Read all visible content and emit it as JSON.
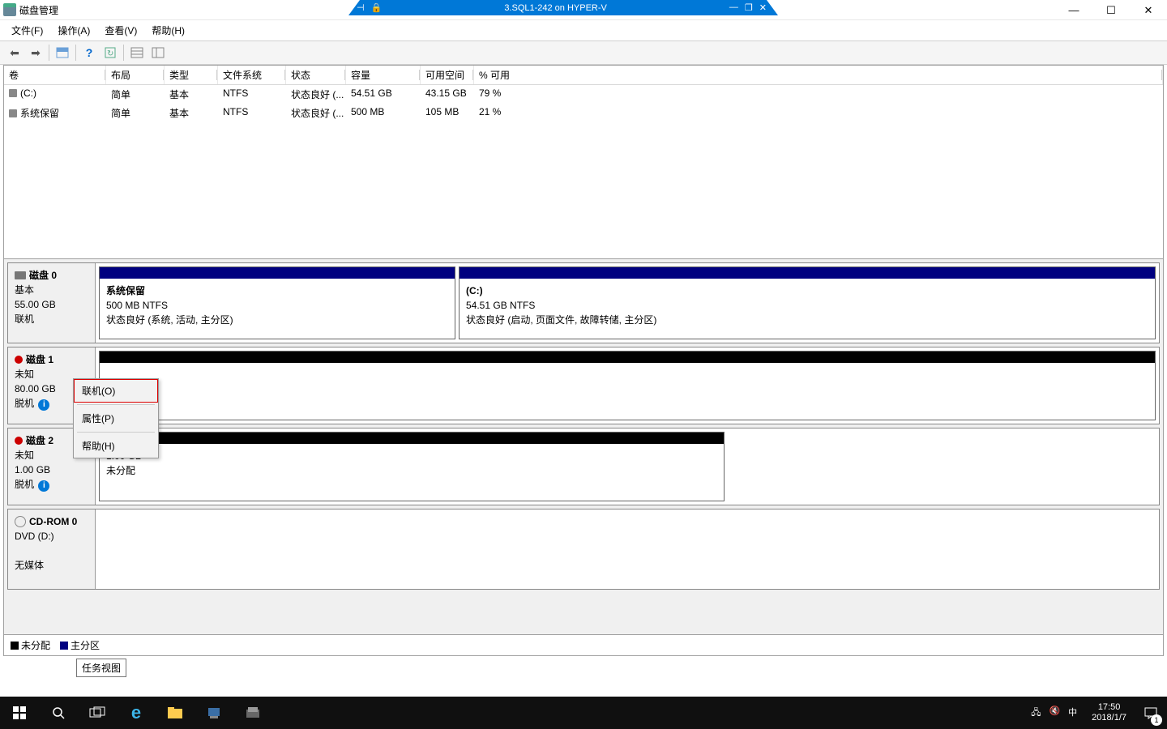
{
  "window": {
    "title": "磁盘管理",
    "vm_title": "3.SQL1-242 on HYPER-V"
  },
  "menu": {
    "file": "文件(F)",
    "action": "操作(A)",
    "view": "查看(V)",
    "help": "帮助(H)"
  },
  "columns": {
    "name": "卷",
    "layout": "布局",
    "type": "类型",
    "fs": "文件系统",
    "status": "状态",
    "cap": "容量",
    "free": "可用空间",
    "pct": "% 可用"
  },
  "volumes": [
    {
      "name": "(C:)",
      "layout": "简单",
      "type": "基本",
      "fs": "NTFS",
      "status": "状态良好 (...",
      "cap": "54.51 GB",
      "free": "43.15 GB",
      "pct": "79 %"
    },
    {
      "name": "系统保留",
      "layout": "简单",
      "type": "基本",
      "fs": "NTFS",
      "status": "状态良好 (...",
      "cap": "500 MB",
      "free": "105 MB",
      "pct": "21 %"
    }
  ],
  "disks": {
    "d0": {
      "name": "磁盘 0",
      "type": "基本",
      "size": "55.00 GB",
      "state": "联机",
      "p1": {
        "name": "系统保留",
        "line2": "500 MB NTFS",
        "line3": "状态良好 (系统, 活动, 主分区)"
      },
      "p2": {
        "name": "(C:)",
        "line2": "54.51 GB NTFS",
        "line3": "状态良好 (启动, 页面文件, 故障转储, 主分区)"
      }
    },
    "d1": {
      "name": "磁盘 1",
      "type": "未知",
      "size": "80.00 GB",
      "state": "脱机"
    },
    "d2": {
      "name": "磁盘 2",
      "type": "未知",
      "size": "1.00 GB",
      "state": "脱机",
      "p1": {
        "line2": "1.00 GB",
        "line3": "未分配"
      }
    },
    "cd": {
      "name": "CD-ROM 0",
      "type": "DVD (D:)",
      "state": "无媒体"
    }
  },
  "context": {
    "online": "联机(O)",
    "props": "属性(P)",
    "help": "帮助(H)"
  },
  "legend": {
    "unalloc": "未分配",
    "primary": "主分区"
  },
  "tooltip": "任务视图",
  "tray": {
    "ime": "中",
    "time": "17:50",
    "date": "2018/1/7",
    "notif": "1"
  }
}
